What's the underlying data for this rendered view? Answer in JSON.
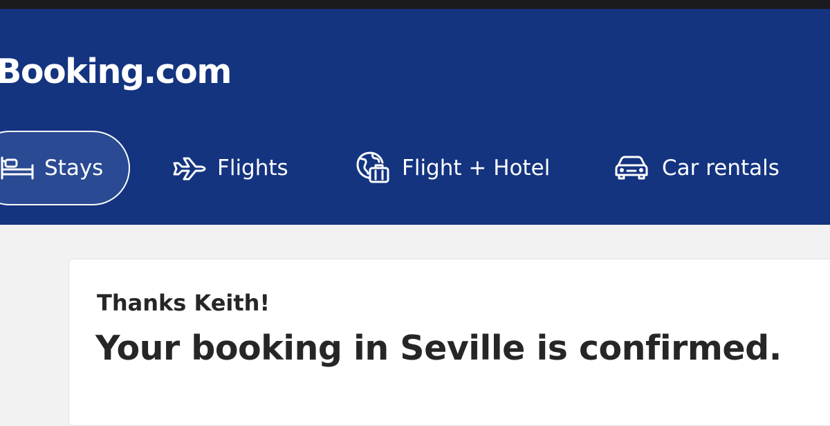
{
  "brand": {
    "logo_text": "Booking.com",
    "header_color": "#143480"
  },
  "nav": {
    "tabs": [
      {
        "label": "Stays",
        "icon": "bed-icon",
        "active": true
      },
      {
        "label": "Flights",
        "icon": "airplane-icon",
        "active": false
      },
      {
        "label": "Flight + Hotel",
        "icon": "globe-suitcase-icon",
        "active": false
      },
      {
        "label": "Car rentals",
        "icon": "car-icon",
        "active": false
      }
    ]
  },
  "confirmation": {
    "greeting": "Thanks Keith!",
    "headline": "Your booking in Seville is confirmed."
  }
}
